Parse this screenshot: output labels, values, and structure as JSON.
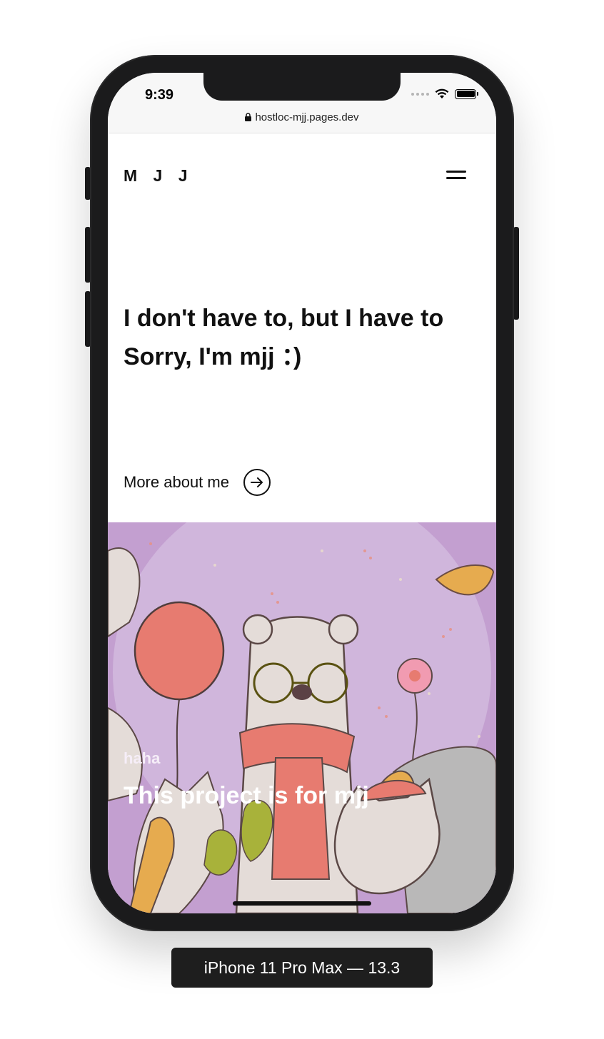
{
  "status_bar": {
    "time": "9:39",
    "url": "hostloc-mjj.pages.dev"
  },
  "header": {
    "logo": "M J J",
    "menu_icon": "hamburger-menu-icon"
  },
  "intro": {
    "line1": "I don't have to, but I have to",
    "line2": "Sorry, I'm mjj ：)",
    "more_link": "More about me",
    "more_icon": "arrow-right-circle-icon"
  },
  "hero": {
    "kicker": "haha",
    "title": "This project is for mjj",
    "background_color": "#c39fd0"
  },
  "device_label": "iPhone 11 Pro Max — 13.3"
}
